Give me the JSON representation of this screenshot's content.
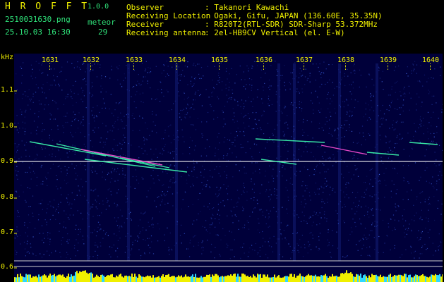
{
  "app": {
    "logo": "H R O F F T",
    "version": "1.0.0"
  },
  "info": {
    "filename": "2510031630.png",
    "datetime": "25.10.03 16:30",
    "meteor_label": "meteor",
    "meteor_count": "29",
    "observer_label": "Observer",
    "observer_value": ": Takanori Kawachi",
    "location_label": "Receiving Location",
    "location_value": ": Ogaki, Gifu, JAPAN (136.60E, 35.35N)",
    "receiver_label": "Receiver",
    "receiver_value": ": R820T2(RTL-SDR) SDR-Sharp 53.372MHz",
    "antenna_label": "Receiving antenna",
    "antenna_value": ": 2el-HB9CV Vertical (el. E-W)"
  },
  "axes": {
    "y_unit": "kHz",
    "y_ticks": [
      "1.1",
      "1.0",
      "0.9",
      "0.8",
      "0.7",
      "0.6"
    ],
    "x_ticks": [
      "1631",
      "1632",
      "1633",
      "1634",
      "1635",
      "1636",
      "1637",
      "1638",
      "1639",
      "1640"
    ]
  },
  "colors": {
    "background": "#00003a",
    "label": "#f0f000",
    "text": "#2fe37a",
    "carrier": "#ffffff",
    "meteor": "#3dffb0",
    "meteor_hot": "#ff4fd8",
    "level_bar": "#f0f000",
    "level_base": "#2fd8ff"
  }
}
